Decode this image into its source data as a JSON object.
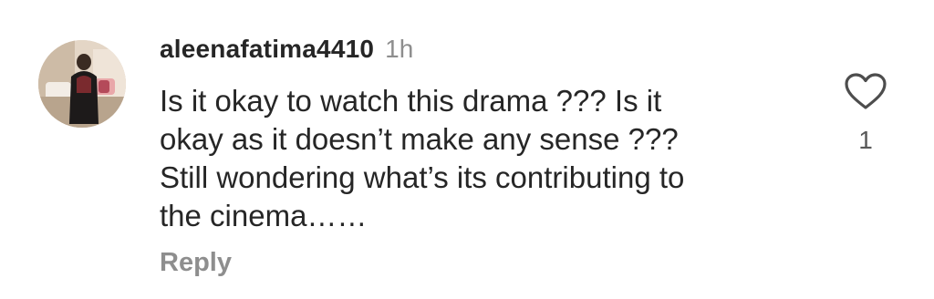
{
  "comment": {
    "username": "aleenafatima4410",
    "timestamp": "1h",
    "body_lines": [
      "Is it okay to watch this drama ??? Is it",
      "okay as it doesn’t make any sense ???",
      "Still wondering what’s its contributing to",
      "the cinema……"
    ],
    "reply_label": "Reply",
    "like_count": "1",
    "like_icon": "heart-outline-icon",
    "avatar_icon": "user-avatar-photo"
  }
}
